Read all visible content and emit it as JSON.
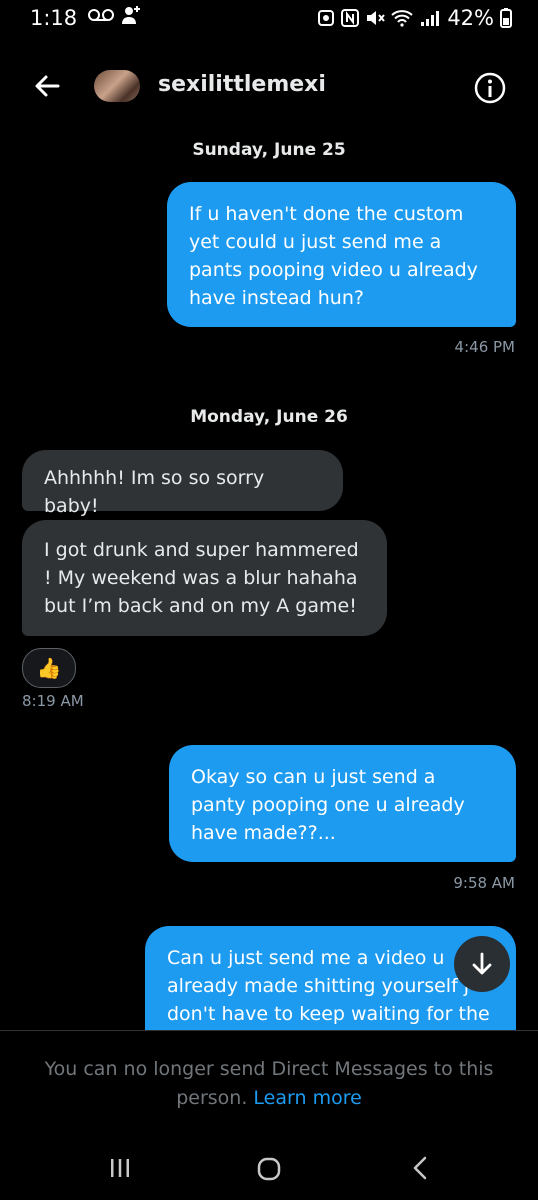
{
  "status_bar": {
    "time": "1:18",
    "battery": "42%"
  },
  "header": {
    "username": "sexilittlemexi"
  },
  "messages": [
    {
      "type": "date",
      "text": "Sunday, June 25"
    },
    {
      "type": "out",
      "text": "If u haven't done the custom yet could u just send me a pants pooping video u already have instead hun?",
      "time": "4:46 PM"
    },
    {
      "type": "date",
      "text": "Monday, June 26"
    },
    {
      "type": "in",
      "text": "Ahhhhh! Im so so sorry baby!"
    },
    {
      "type": "in",
      "text": "I got drunk and super hammered ! My weekend was a blur hahaha but I’m back and on my A game!",
      "time": "8:19 AM",
      "reaction": "👍"
    },
    {
      "type": "out",
      "text": "Okay so can u just send a panty pooping one u already have made??...",
      "time": "9:58 AM"
    },
    {
      "type": "out",
      "text": "Can u just send me a video u already made shitting yourself j don't have to keep waiting for the"
    }
  ],
  "footer": {
    "notice": "You can no longer send Direct Messages to this person.",
    "link": "Learn more"
  },
  "icons": {
    "back": "arrow-left-icon",
    "info": "info-icon",
    "scroll": "arrow-down-icon",
    "nav": [
      "recent-apps-icon",
      "home-icon",
      "back-nav-icon"
    ]
  },
  "colors": {
    "accent": "#1d9bf0",
    "incoming_bubble": "#2f3336",
    "background": "#000000"
  }
}
